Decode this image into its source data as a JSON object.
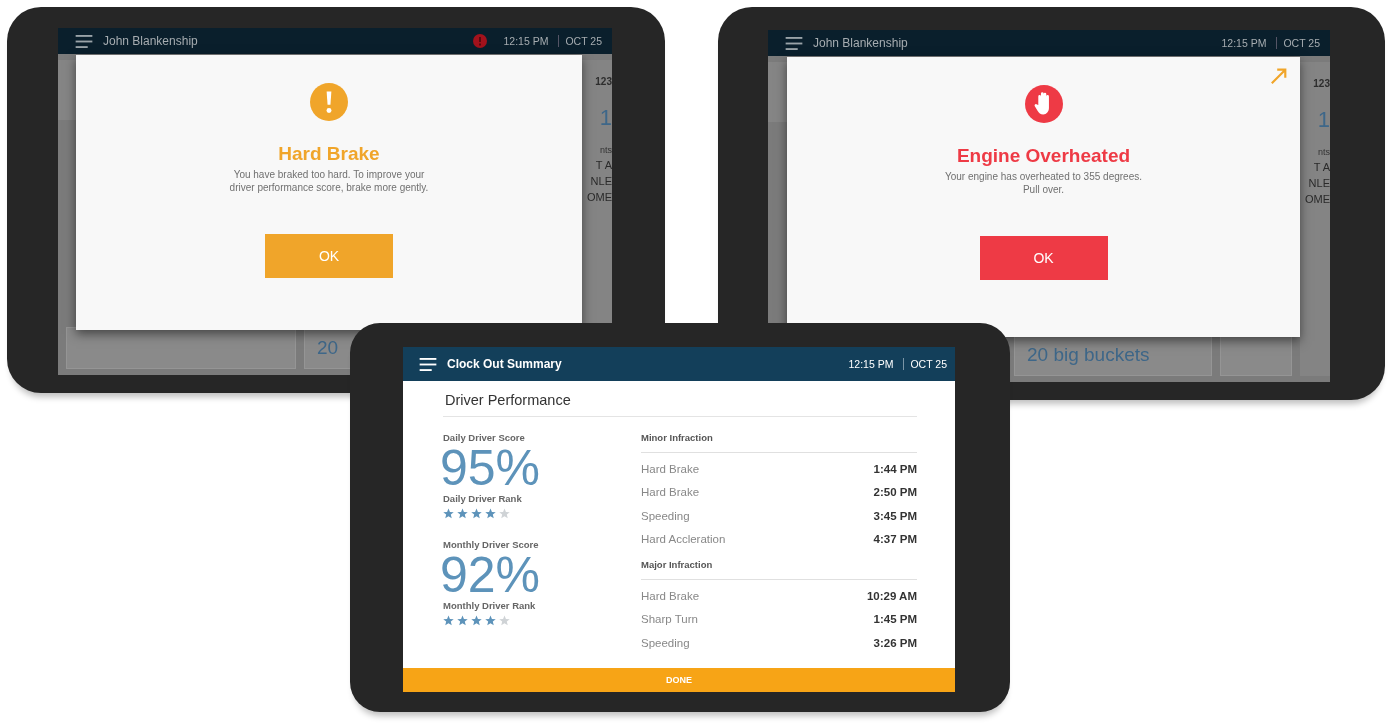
{
  "alert_tablets": [
    {
      "header": {
        "name": "John Blankenship",
        "alert_badge": true,
        "time": "12:15 PM",
        "date": "OCT 25"
      },
      "background": {
        "card_text": "20",
        "side_code": "123",
        "side_number": "1",
        "side_lines": [
          "nts",
          "T A",
          "NLE",
          "OME"
        ]
      },
      "dialog": {
        "kind": "warning",
        "title": "Hard Brake",
        "message": "You have braked too hard. To improve your driver performance score, brake more gently.",
        "button": "OK",
        "expand_arrow": false
      }
    },
    {
      "header": {
        "name": "John Blankenship",
        "alert_badge": false,
        "time": "12:15 PM",
        "date": "OCT 25"
      },
      "background": {
        "card_text": "20 big buckets",
        "side_code": "123",
        "side_number": "1",
        "side_lines": [
          "nts",
          "T A",
          "NLE",
          "OME"
        ]
      },
      "dialog": {
        "kind": "stop",
        "title": "Engine Overheated",
        "message": "Your engine has overheated to 355 degrees. Pull over.",
        "button": "OK",
        "expand_arrow": true
      }
    }
  ],
  "summary_tablet": {
    "header": {
      "title": "Clock Out Summary",
      "time": "12:15 PM",
      "date": "OCT 25"
    },
    "section_title": "Driver Performance",
    "scores": [
      {
        "label": "Daily Driver Score",
        "value": "95%",
        "rank_label": "Daily Driver Rank",
        "stars": 4
      },
      {
        "label": "Monthly Driver Score",
        "value": "92%",
        "rank_label": "Monthly Driver Rank",
        "stars": 4
      }
    ],
    "infraction_groups": [
      {
        "title": "Minor Infraction",
        "rows": [
          {
            "name": "Hard Brake",
            "time": "1:44 PM"
          },
          {
            "name": "Hard Brake",
            "time": "2:50 PM"
          },
          {
            "name": "Speeding",
            "time": "3:45 PM"
          },
          {
            "name": "Hard Accleration",
            "time": "4:37 PM"
          }
        ]
      },
      {
        "title": "Major Infraction",
        "rows": [
          {
            "name": "Hard Brake",
            "time": "10:29 AM"
          },
          {
            "name": "Sharp Turn",
            "time": "1:45 PM"
          },
          {
            "name": "Speeding",
            "time": "3:26 PM"
          }
        ]
      }
    ],
    "done_button": "DONE"
  }
}
